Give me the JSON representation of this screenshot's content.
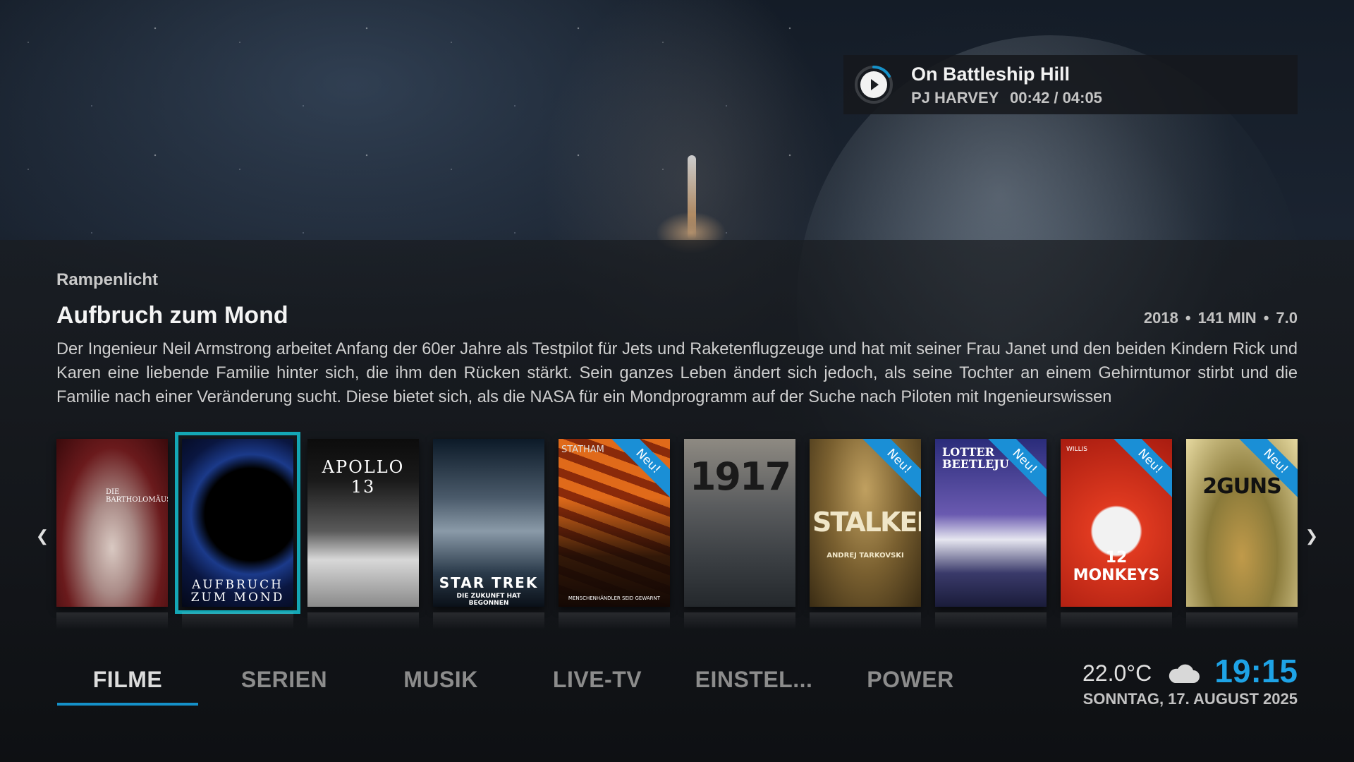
{
  "now_playing": {
    "title": "On Battleship Hill",
    "artist": "PJ HARVEY",
    "elapsed": "00:42",
    "duration": "04:05",
    "time_display": "00:42 / 04:05",
    "progress": 0.17,
    "icon": "play-icon"
  },
  "spotlight": {
    "section_label": "Rampenlicht",
    "title": "Aufbruch zum Mond",
    "year": "2018",
    "runtime": "141 MIN",
    "rating": "7.0",
    "separator": "•",
    "plot": "Der Ingenieur Neil Armstrong arbeitet Anfang der 60er Jahre als Testpilot für Jets und Raketenflugzeuge und hat mit seiner Frau Janet und den beiden Kindern Rick und Karen eine liebende Familie hinter sich, die ihm den Rücken stärkt. Sein ganzes Leben ändert sich jedoch, als seine Tochter an einem Gehirntumor stirbt und die Familie nach einer Veränderung sucht. Diese bietet sich, als die NASA für ein Mondprogramm auf der Suche nach Piloten mit Ingenieurswissen"
  },
  "posters": [
    {
      "poster_text": "DIE BARTHOLOMÄUSNACHT",
      "badge": "",
      "colors": [
        "#7a1a1c",
        "#c9b8b0"
      ]
    },
    {
      "poster_text": "AUFBRUCH ZUM MOND",
      "badge": "",
      "colors": [
        "#0a1640",
        "#1b3a8a"
      ],
      "selected": true
    },
    {
      "poster_text": "APOLLO 13",
      "badge": "",
      "colors": [
        "#0c0c0c",
        "#6a6a6a"
      ]
    },
    {
      "poster_text": "STAR TREK",
      "poster_subtext": "DIE ZUKUNFT HAT BEGONNEN",
      "badge": "",
      "colors": [
        "#0c1a28",
        "#8a9aa8"
      ]
    },
    {
      "poster_text": "STATHAM",
      "poster_subtext": "MENSCHENHÄNDLER SEID GEWARNT",
      "badge": "Neu!",
      "colors": [
        "#2a1206",
        "#e06a1a"
      ]
    },
    {
      "poster_text": "1917",
      "badge": "",
      "colors": [
        "#3c4044",
        "#8e8a82"
      ]
    },
    {
      "poster_text": "STALKER",
      "poster_subtext": "ANDREJ TARKOVSKI",
      "badge": "Neu!",
      "colors": [
        "#4a3c1e",
        "#b89a5a"
      ]
    },
    {
      "poster_text": "LOTTER BEETLEJU",
      "badge": "Neu!",
      "colors": [
        "#1a1c5a",
        "#8a7ac8"
      ]
    },
    {
      "poster_text": "12 MONKEYS",
      "poster_subtext": "WILLIS",
      "badge": "Neu!",
      "colors": [
        "#a81c10",
        "#e03a20"
      ]
    },
    {
      "poster_text": "2GUNS",
      "badge": "Neu!",
      "colors": [
        "#8a7a3a",
        "#e6d9a0"
      ]
    }
  ],
  "menu": {
    "items": [
      "FILME",
      "SERIEN",
      "MUSIK",
      "LIVE-TV",
      "EINSTEL...",
      "POWER"
    ],
    "active_index": 0
  },
  "status": {
    "temperature": "22.0°C",
    "weather_icon": "cloud-icon",
    "time": "19:15",
    "date": "SONNTAG, 17. AUGUST 2025"
  },
  "colors": {
    "accent": "#1591c9",
    "selection": "#14a7b5",
    "clock": "#1ea3e6",
    "badge": "#1a8fd6"
  }
}
